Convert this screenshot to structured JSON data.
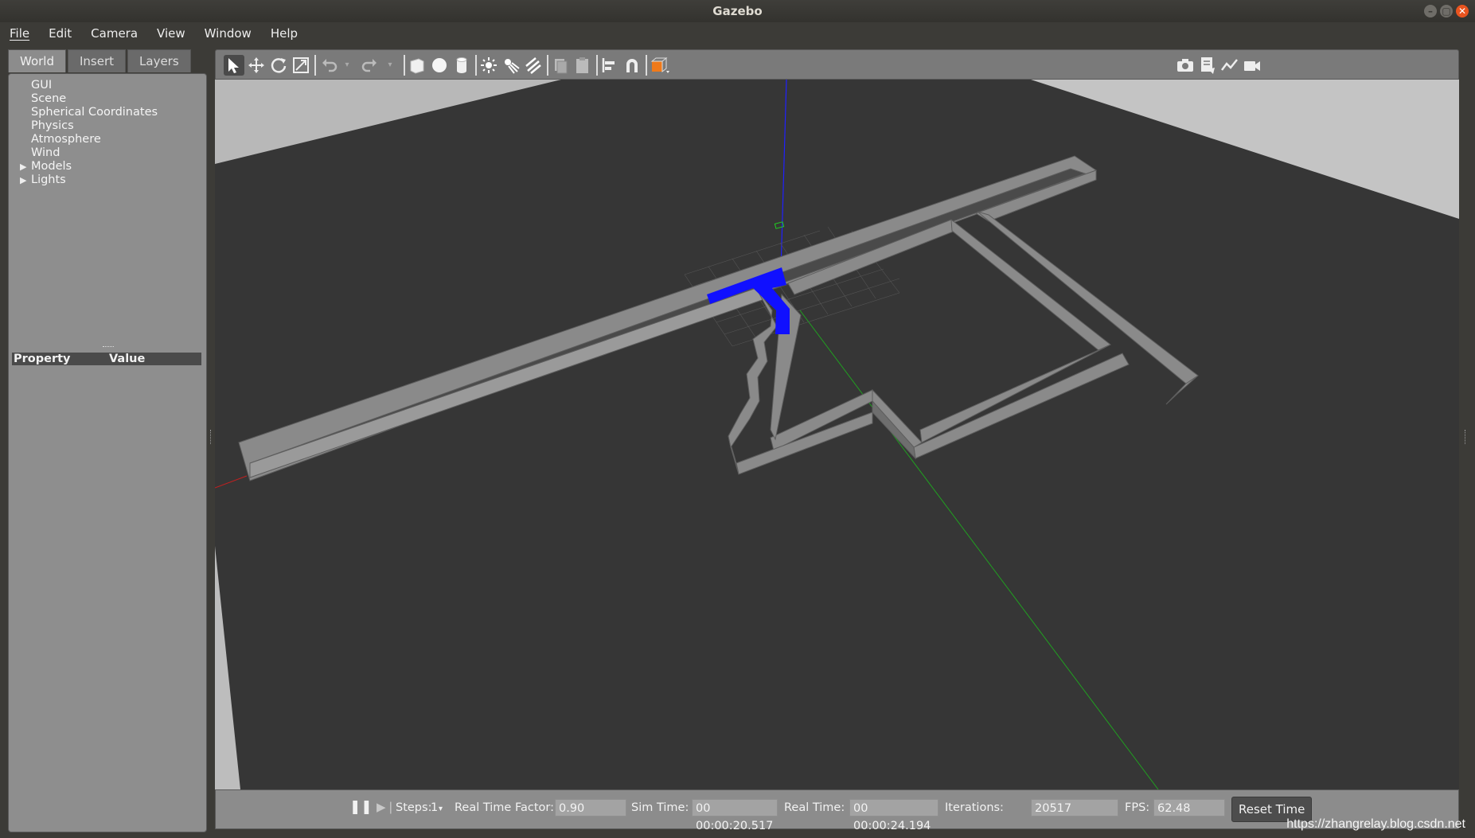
{
  "window": {
    "title": "Gazebo"
  },
  "menubar": {
    "items": [
      "File",
      "Edit",
      "Camera",
      "View",
      "Window",
      "Help"
    ]
  },
  "left_panel": {
    "tabs": [
      {
        "label": "World",
        "active": true
      },
      {
        "label": "Insert",
        "active": false
      },
      {
        "label": "Layers",
        "active": false
      }
    ],
    "tree": [
      {
        "label": "GUI",
        "expandable": false
      },
      {
        "label": "Scene",
        "expandable": false
      },
      {
        "label": "Spherical Coordinates",
        "expandable": false
      },
      {
        "label": "Physics",
        "expandable": false
      },
      {
        "label": "Atmosphere",
        "expandable": false
      },
      {
        "label": "Wind",
        "expandable": false
      },
      {
        "label": "Models",
        "expandable": true
      },
      {
        "label": "Lights",
        "expandable": true
      }
    ],
    "property_header": {
      "property": "Property",
      "value": "Value"
    }
  },
  "toolbar": {
    "icons": [
      "select-arrow-icon",
      "translate-icon",
      "rotate-icon",
      "scale-icon",
      "undo-icon",
      "undo-history-icon",
      "redo-icon",
      "redo-history-icon",
      "box-shape-icon",
      "sphere-shape-icon",
      "cylinder-shape-icon",
      "point-light-icon",
      "spot-light-icon",
      "directional-light-icon",
      "copy-icon",
      "paste-icon",
      "align-icon",
      "snap-magnet-icon",
      "view-angle-icon",
      "screenshot-icon",
      "log-icon",
      "plot-icon",
      "record-video-icon"
    ],
    "view_angle_color": "#f07a1a"
  },
  "status": {
    "steps_label": "Steps:",
    "steps_value": "1",
    "rtf_label": "Real Time Factor:",
    "rtf_value": "0.90",
    "sim_time_label": "Sim Time:",
    "sim_time_value": "00 00:00:20.517",
    "real_time_label": "Real Time:",
    "real_time_value": "00 00:00:24.194",
    "iterations_label": "Iterations:",
    "iterations_value": "20517",
    "fps_label": "FPS:",
    "fps_value": "62.48",
    "reset_label": "Reset Time"
  },
  "scene": {
    "ground_color": "#363636",
    "wall_color": "#8a8a8a",
    "selected_color": "#1010ff",
    "z_axis_color": "#2020ff",
    "y_axis_color": "#20a020",
    "x_axis_color": "#c02020"
  },
  "watermark": "https://zhangrelay.blog.csdn.net"
}
